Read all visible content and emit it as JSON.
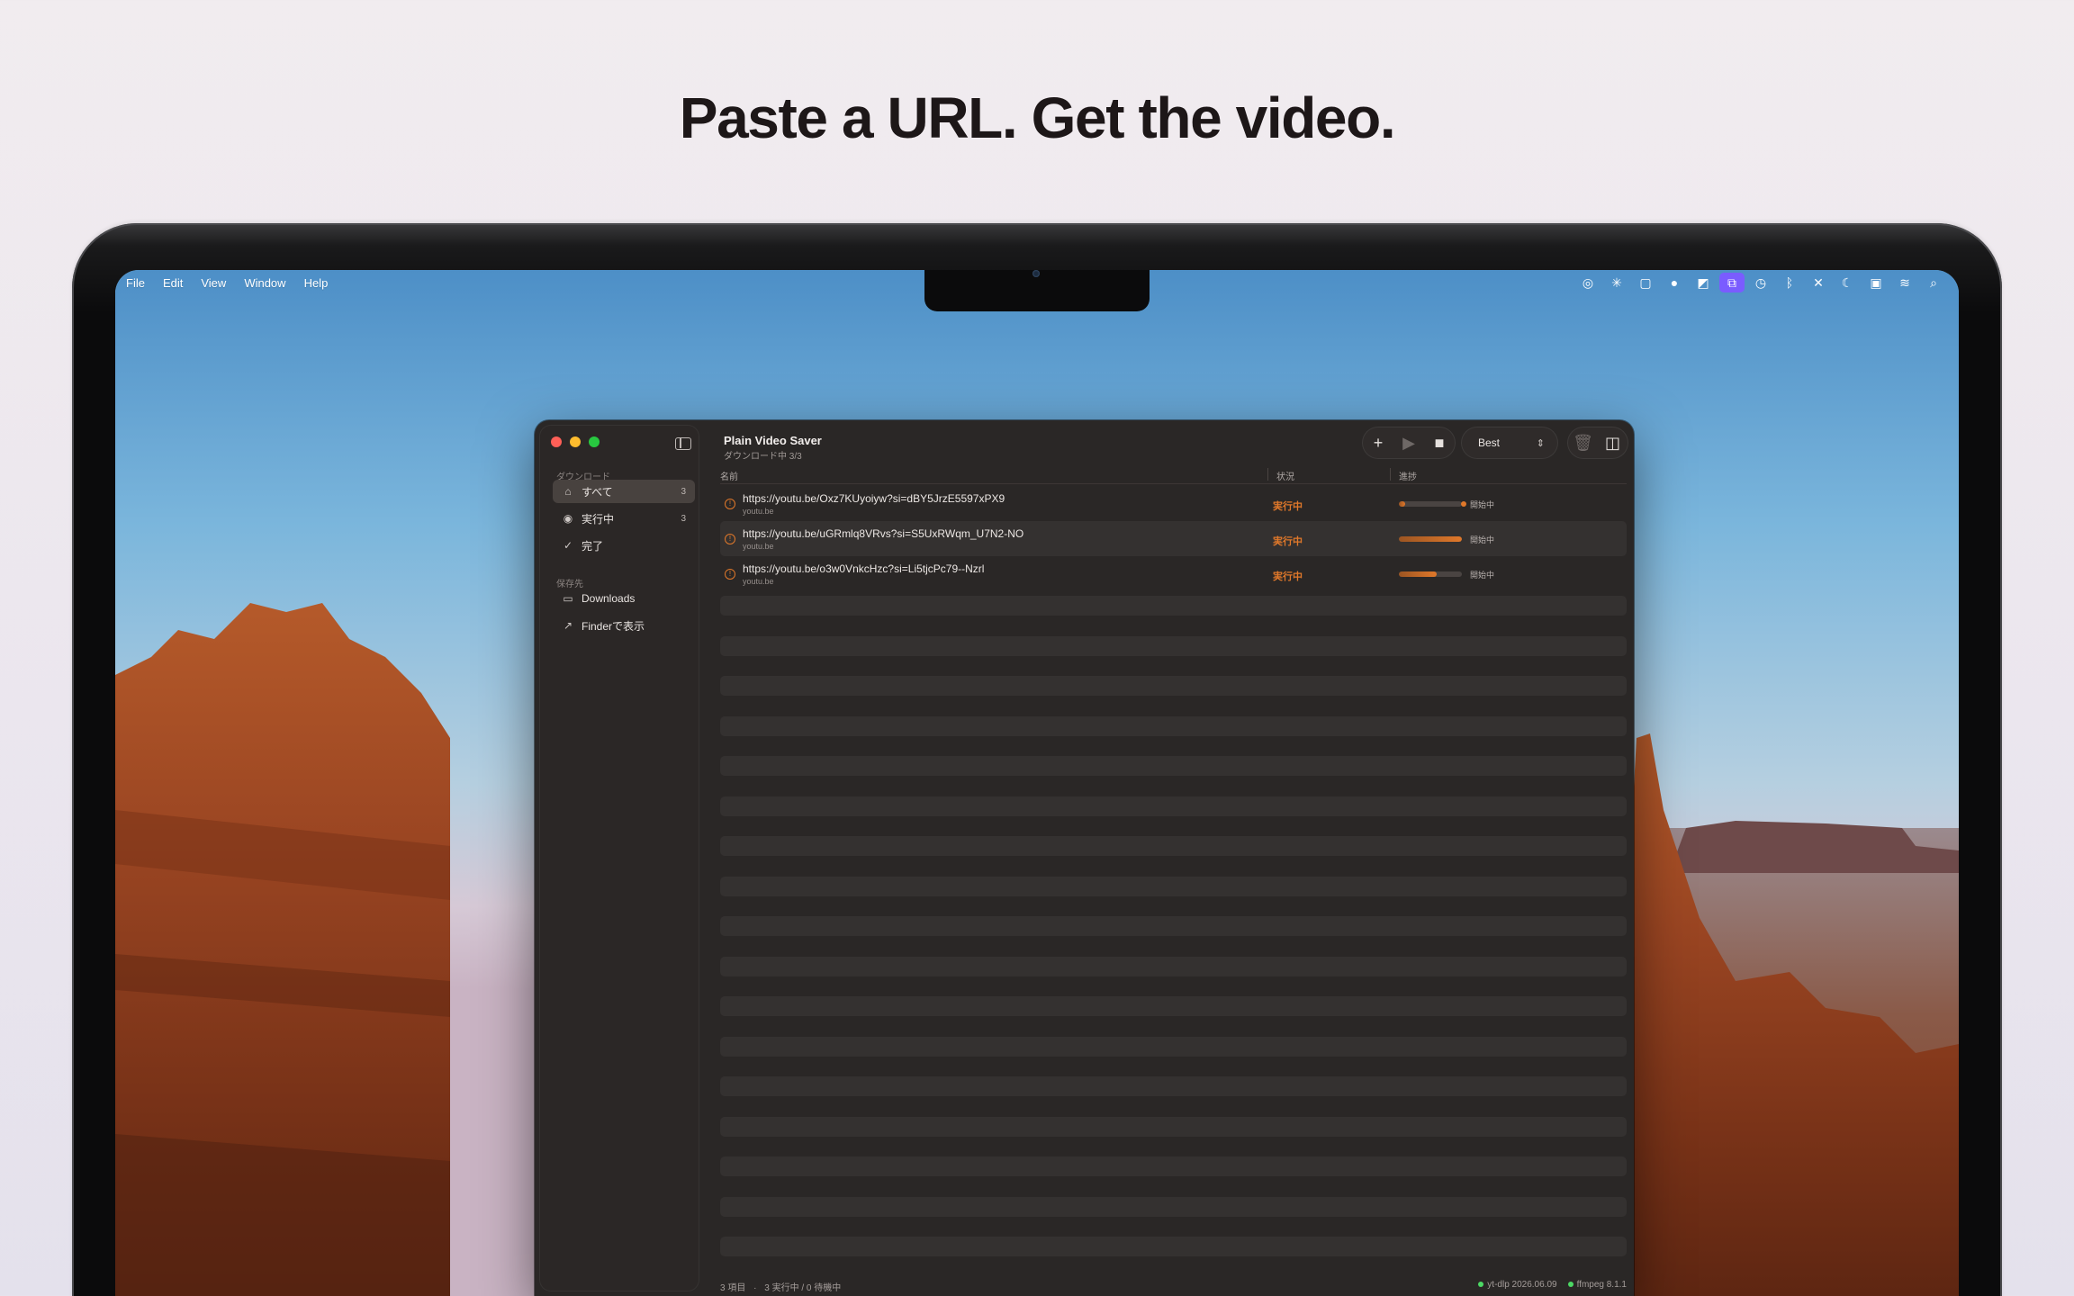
{
  "headline": "Paste a URL. Get the video.",
  "menubar": {
    "items": [
      "File",
      "Edit",
      "View",
      "Window",
      "Help"
    ]
  },
  "app": {
    "title": "Plain Video Saver",
    "subtitle": "ダウンロード中 3/3",
    "quality": "Best",
    "columns": {
      "name": "名前",
      "status": "状況",
      "progress": "進捗"
    }
  },
  "sidebar": {
    "section_downloads": "ダウンロード",
    "section_destination": "保存先",
    "items": [
      {
        "label": "すべて",
        "count": "3"
      },
      {
        "label": "実行中",
        "count": "3"
      },
      {
        "label": "完了",
        "count": ""
      }
    ],
    "destinations": [
      {
        "label": "Downloads"
      },
      {
        "label": "Finderで表示"
      }
    ]
  },
  "downloads": [
    {
      "url": "https://youtu.be/Oxz7KUyoiyw?si=dBY5JrzE5597xPX9",
      "host": "youtu.be",
      "status": "実行中",
      "progress_label": "開始中",
      "progress": 0.1
    },
    {
      "url": "https://youtu.be/uGRmlq8VRvs?si=S5UxRWqm_U7N2-NO",
      "host": "youtu.be",
      "status": "実行中",
      "progress_label": "開始中",
      "progress": 1.0
    },
    {
      "url": "https://youtu.be/o3w0VnkcHzc?si=Li5tjcPc79--Nzrl",
      "host": "youtu.be",
      "status": "実行中",
      "progress_label": "開始中",
      "progress": 0.6
    }
  ],
  "footer": {
    "items_count": "3 項目",
    "running": "3 実行中 / 0 待機中",
    "ytdlp": "yt-dlp 2026.06.09",
    "ffmpeg": "ffmpeg 8.1.1"
  },
  "colors": {
    "accent": "#e0782a",
    "window_bg": "#2a2726",
    "traffic_red": "#ff5f57",
    "traffic_yellow": "#febc2e",
    "traffic_green": "#28c840",
    "status_dot": "#4cd964"
  }
}
